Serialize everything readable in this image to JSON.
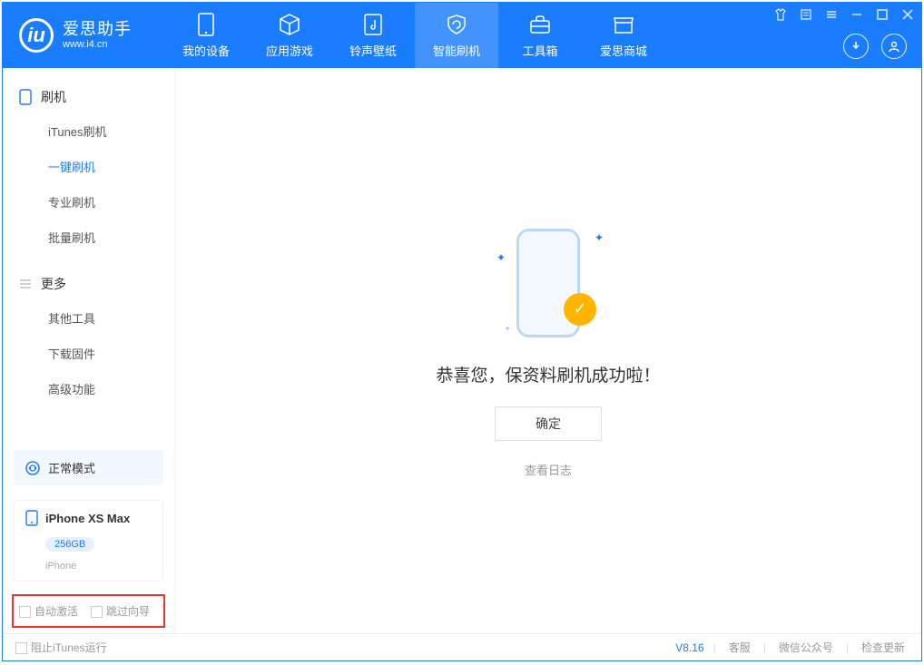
{
  "brand": {
    "name": "爱思助手",
    "url": "www.i4.cn"
  },
  "nav": [
    {
      "label": "我的设备"
    },
    {
      "label": "应用游戏"
    },
    {
      "label": "铃声壁纸"
    },
    {
      "label": "智能刷机"
    },
    {
      "label": "工具箱"
    },
    {
      "label": "爱思商城"
    }
  ],
  "sidebar": {
    "group1_title": "刷机",
    "group1": [
      {
        "label": "iTunes刷机"
      },
      {
        "label": "一键刷机"
      },
      {
        "label": "专业刷机"
      },
      {
        "label": "批量刷机"
      }
    ],
    "group2_title": "更多",
    "group2": [
      {
        "label": "其他工具"
      },
      {
        "label": "下载固件"
      },
      {
        "label": "高级功能"
      }
    ]
  },
  "mode": {
    "label": "正常模式"
  },
  "device": {
    "name": "iPhone XS Max",
    "storage": "256GB",
    "type": "iPhone"
  },
  "options": {
    "auto_activate": "自动激活",
    "skip_wizard": "跳过向导"
  },
  "main": {
    "success_text": "恭喜您，保资料刷机成功啦！",
    "ok_button": "确定",
    "view_log": "查看日志"
  },
  "status": {
    "block_itunes": "阻止iTunes运行",
    "version": "V8.16",
    "customer_service": "客服",
    "wechat": "微信公众号",
    "check_update": "检查更新"
  }
}
